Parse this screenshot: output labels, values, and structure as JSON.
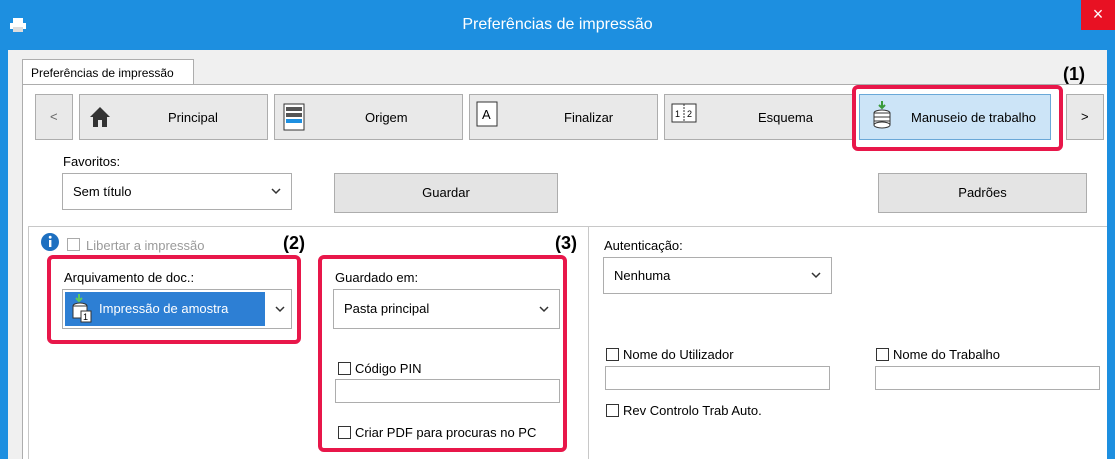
{
  "window": {
    "title": "Preferências de impressão",
    "close_glyph": "×"
  },
  "tab": {
    "label": "Preferências de impressão"
  },
  "nav": {
    "prev": "<",
    "next": ">",
    "items": [
      {
        "label": "Principal",
        "icon": "home-icon"
      },
      {
        "label": "Origem",
        "icon": "paper-tray-icon"
      },
      {
        "label": "Finalizar",
        "icon": "finishing-icon"
      },
      {
        "label": "Esquema",
        "icon": "layout-icon"
      },
      {
        "label": "Manuseio de trabalho",
        "icon": "job-handling-icon"
      }
    ]
  },
  "favorites": {
    "label": "Favoritos:",
    "value": "Sem título",
    "save": "Guardar",
    "defaults": "Padrões"
  },
  "release": {
    "label": "Libertar a impressão"
  },
  "doc_filing": {
    "label": "Arquivamento de doc.:",
    "value": "Impressão de amostra"
  },
  "stored_in": {
    "label": "Guardado em:",
    "value": "Pasta principal",
    "pin_label": "Código PIN",
    "pdf_label": "Criar PDF para procuras no PC"
  },
  "auth": {
    "label": "Autenticação:",
    "value": "Nenhuma"
  },
  "user_name": {
    "label": "Nome do Utilizador"
  },
  "job_name": {
    "label": "Nome do Trabalho"
  },
  "job_control": {
    "label": "Rev Controlo Trab Auto."
  },
  "callouts": {
    "c1": "(1)",
    "c2": "(2)",
    "c3": "(3)"
  },
  "colors": {
    "accent": "#1d8fe0",
    "callout": "#e8174a",
    "selected": "#2d7fd4",
    "close": "#e81123"
  }
}
